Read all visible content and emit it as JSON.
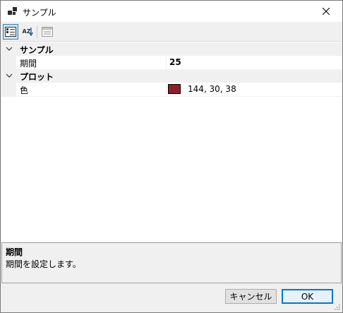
{
  "window": {
    "title": "サンプル"
  },
  "toolbar": {
    "categorized_tooltip": "分類順",
    "alphabetical_label": "AZ",
    "pages_tooltip": "プロパティ ページ"
  },
  "grid": {
    "categories": [
      {
        "label": "サンプル",
        "properties": [
          {
            "name": "期間",
            "value": "25"
          }
        ]
      },
      {
        "label": "プロット",
        "properties": [
          {
            "name": "色",
            "value": "144, 30, 38",
            "color": "#901e26"
          }
        ]
      }
    ]
  },
  "help": {
    "title": "期間",
    "description": "期間を設定します。"
  },
  "buttons": {
    "cancel": "キャンセル",
    "ok": "OK"
  }
}
